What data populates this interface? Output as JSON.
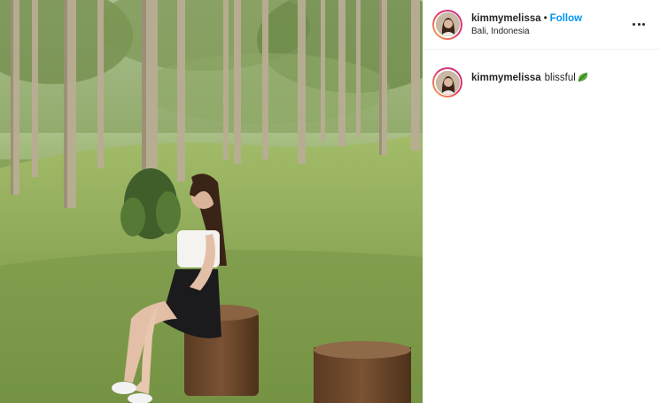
{
  "post": {
    "username": "kimmymelissa",
    "separator": "•",
    "follow_label": "Follow",
    "location": "Bali, Indonesia",
    "caption_text": "blissful",
    "caption_emoji": "leaf-icon",
    "photo_subject": "woman sitting on tree stump in forest park",
    "colors": {
      "follow": "#0095f6",
      "text": "#262626",
      "divider": "#efefef",
      "story_ring": "#e1306c"
    }
  }
}
